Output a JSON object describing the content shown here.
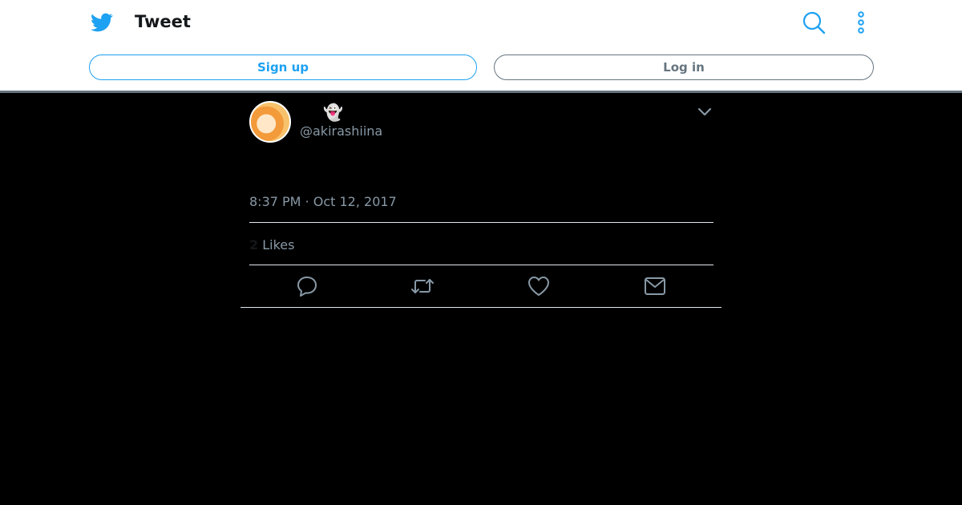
{
  "header": {
    "title": "Tweet",
    "logo_icon": "twitter-bird-icon",
    "search_icon": "search-icon",
    "more_icon": "more-vertical-icon",
    "accent_color": "#1da1f2"
  },
  "auth": {
    "signup_label": "Sign up",
    "login_label": "Log in"
  },
  "tweet": {
    "handle": "@akirashiina",
    "display_name_emoji": "👻",
    "timestamp": "8:37 PM · Oct 12, 2017",
    "likes_count": "2",
    "likes_label": "Likes",
    "actions": [
      "reply-icon",
      "retweet-icon",
      "like-icon",
      "message-icon"
    ]
  }
}
